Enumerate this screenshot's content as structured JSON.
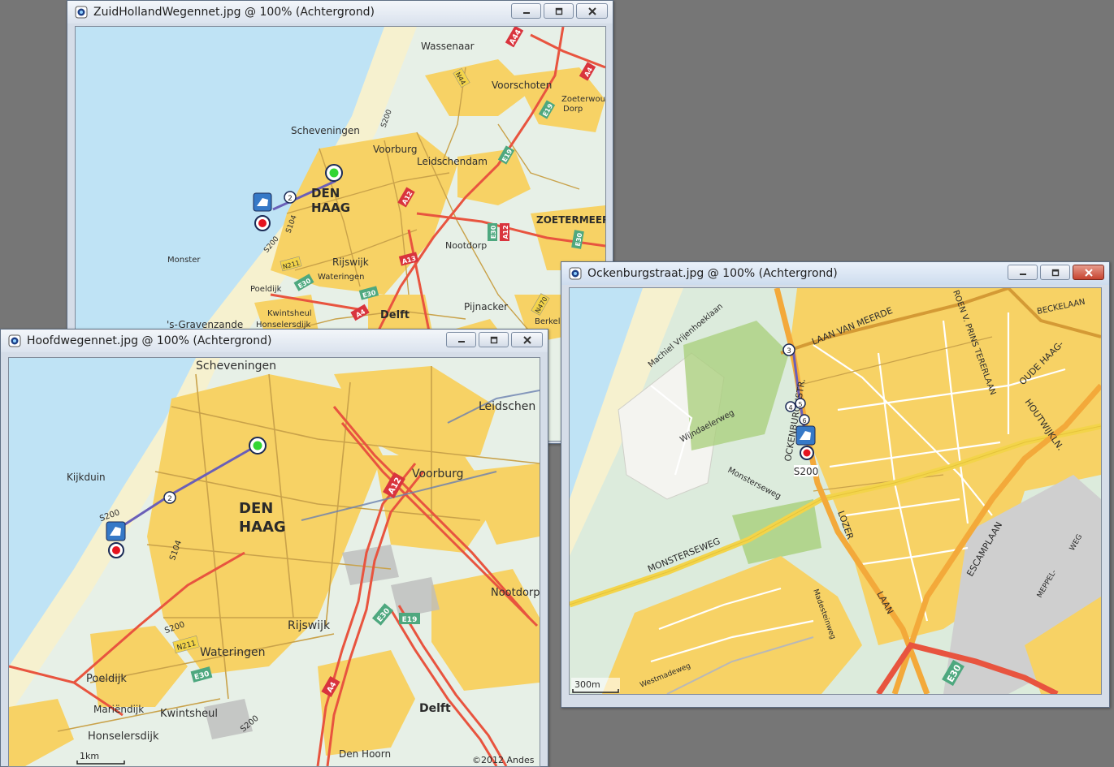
{
  "windows": {
    "zh": {
      "title": "ZuidHollandWegennet.jpg @ 100% (Achtergrond)",
      "places": {
        "wassenaar": "Wassenaar",
        "voorschoten": "Voorschoten",
        "zoeterwoude": "Zoeterwoude",
        "dorp": "Dorp",
        "scheveningen": "Scheveningen",
        "voorburg": "Voorburg",
        "leidschendam": "Leidschendam",
        "den": "DEN",
        "haag": "HAAG",
        "zoetermeer": "ZOETERMEER",
        "nootdorp": "Nootdorp",
        "monster": "Monster",
        "rijswijk": "Rijswijk",
        "poeldijk": "Poeldijk",
        "wateringen": "Wateringen",
        "pijnacker": "Pijnacker",
        "kwintsheul": "Kwintsheul",
        "delft": "Delft",
        "gravenzande": "'s-Gravenzande",
        "honselersdijk": "Honselersdijk",
        "berkel": "Berkel"
      },
      "roads": {
        "a44": "A44",
        "n44": "N44",
        "a4": "A4",
        "e19": "E19",
        "s200": "S200",
        "a12": "A12",
        "e30": "E30",
        "s104": "S104",
        "n211": "N211",
        "a13": "A13",
        "n470": "N470",
        "a4b": "A4",
        "waypoint": "2"
      }
    },
    "hoofd": {
      "title": "Hoofdwegennet.jpg @ 100% (Achtergrond)",
      "places": {
        "scheveningen": "Scheveningen",
        "leidschendam": "Leidschen",
        "kijkduin": "Kijkduin",
        "den": "DEN",
        "haag": "HAAG",
        "voorburg": "Voorburg",
        "nootdorp": "Nootdorp",
        "rijswijk": "Rijswijk",
        "wateringen": "Wateringen",
        "poeldijk": "Poeldijk",
        "mariendijk": "Mariëndijk",
        "kwintsheul": "Kwintsheul",
        "honselersdijk": "Honselersdijk",
        "delft": "Delft",
        "denhoorn": "Den Hoorn"
      },
      "roads": {
        "s200a": "S200",
        "s104": "S104",
        "a12": "A12",
        "e30": "E30",
        "e19": "E19",
        "s200b": "S200",
        "n211": "N211",
        "e30b": "E30",
        "a4": "A4",
        "s200c": "S200",
        "waypoint": "2"
      },
      "scale": "1km",
      "copyright": "©2012 Andes"
    },
    "ock": {
      "title": "Ockenburgstraat.jpg @ 100% (Achtergrond)",
      "streets": {
        "vrijenhoek": "Machiel Vrijenhoeklaan",
        "laanvanmeerdervoort": "LAAN VAN MEERDE",
        "beckelaan": "BECKELAAN",
        "prins": "ROEN V. PRINS TERERLAAN",
        "oudehaag": "OUDE HAAG-",
        "houtwijk": "HOUTWIJKLN.",
        "ockenburgh": "OCKENBURGHSTR.",
        "wijndaelerweg": "Wijndaelerweg",
        "monsterseweg": "Monsterseweg",
        "monsterseweg2": "MONSTERSEWEG",
        "lozer": "LOZER",
        "laan": "LAAN",
        "escamplaan": "ESCAMPLAAN",
        "meppel": "MEPPEL-",
        "weg": "WEG",
        "madestein": "Madesteinweg",
        "westmade": "Westmadeweg"
      },
      "roads": {
        "s200": "S200",
        "e30": "E30",
        "w3": "3",
        "w4": "4",
        "w5": "5",
        "w6": "6"
      },
      "scale": "300m"
    }
  }
}
